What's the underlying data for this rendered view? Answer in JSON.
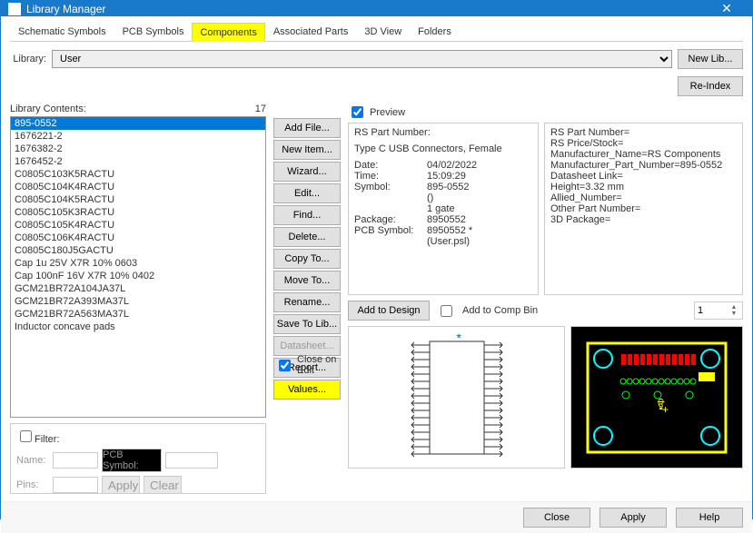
{
  "window": {
    "title": "Library Manager"
  },
  "tabs": [
    "Schematic Symbols",
    "PCB Symbols",
    "Components",
    "Associated Parts",
    "3D View",
    "Folders"
  ],
  "active_tab": 2,
  "library": {
    "label": "Library:",
    "value": "User",
    "newlib": "New Lib...",
    "reindex": "Re-Index"
  },
  "contents": {
    "label": "Library Contents:",
    "count": "17",
    "items": [
      "895-0552",
      "1676221-2",
      "1676382-2",
      "1676452-2",
      "C0805C103K5RACTU",
      "C0805C104K4RACTU",
      "C0805C104K5RACTU",
      "C0805C105K3RACTU",
      "C0805C105K4RACTU",
      "C0805C106K4RACTU",
      "C0805C180J5GACTU",
      "Cap 1u 25V X7R 10% 0603",
      "Cap 100nF 16V X7R 10% 0402",
      "GCM21BR72A104JA37L",
      "GCM21BR72A393MA37L",
      "GCM21BR72A563MA37L",
      "Inductor concave pads"
    ],
    "selected": 0
  },
  "buttons": {
    "addfile": "Add File...",
    "newitem": "New Item...",
    "wizard": "Wizard...",
    "edit": "Edit...",
    "find": "Find...",
    "delete": "Delete...",
    "copyto": "Copy To...",
    "moveto": "Move To...",
    "rename": "Rename...",
    "savetolib": "Save To Lib...",
    "datasheet": "Datasheet...",
    "report": "Report...",
    "values": "Values..."
  },
  "filter": {
    "label": "Filter:",
    "name": "Name:",
    "pcb": "PCB Symbol:",
    "pins": "Pins:",
    "apply": "Apply",
    "clear": "Clear"
  },
  "preview": {
    "label": "Preview",
    "rs": "RS Part Number:",
    "desc": "Type C USB Connectors, Female",
    "kv": [
      [
        "Date:",
        "04/02/2022"
      ],
      [
        "Time:",
        "15:09:29"
      ],
      [
        "Symbol:",
        "895-0552"
      ],
      [
        "",
        "()"
      ],
      [
        "",
        "1 gate"
      ],
      [
        "Package:",
        "8950552"
      ],
      [
        "PCB Symbol:",
        "8950552 *"
      ],
      [
        "",
        "(User.psl)"
      ]
    ],
    "attrs": [
      "RS Part Number=",
      "RS Price/Stock=",
      "Manufacturer_Name=RS Components",
      "Manufacturer_Part_Number=895-0552",
      "Datasheet Link=",
      "Height=3.32 mm",
      "Allied_Number=",
      "Other Part Number=",
      "3D Package="
    ],
    "addbtn": "Add to Design",
    "addbin": "Add to Comp Bin",
    "spin": "1",
    "closeedit": "Close on Edit"
  },
  "footer": {
    "close": "Close",
    "apply": "Apply",
    "help": "Help"
  }
}
